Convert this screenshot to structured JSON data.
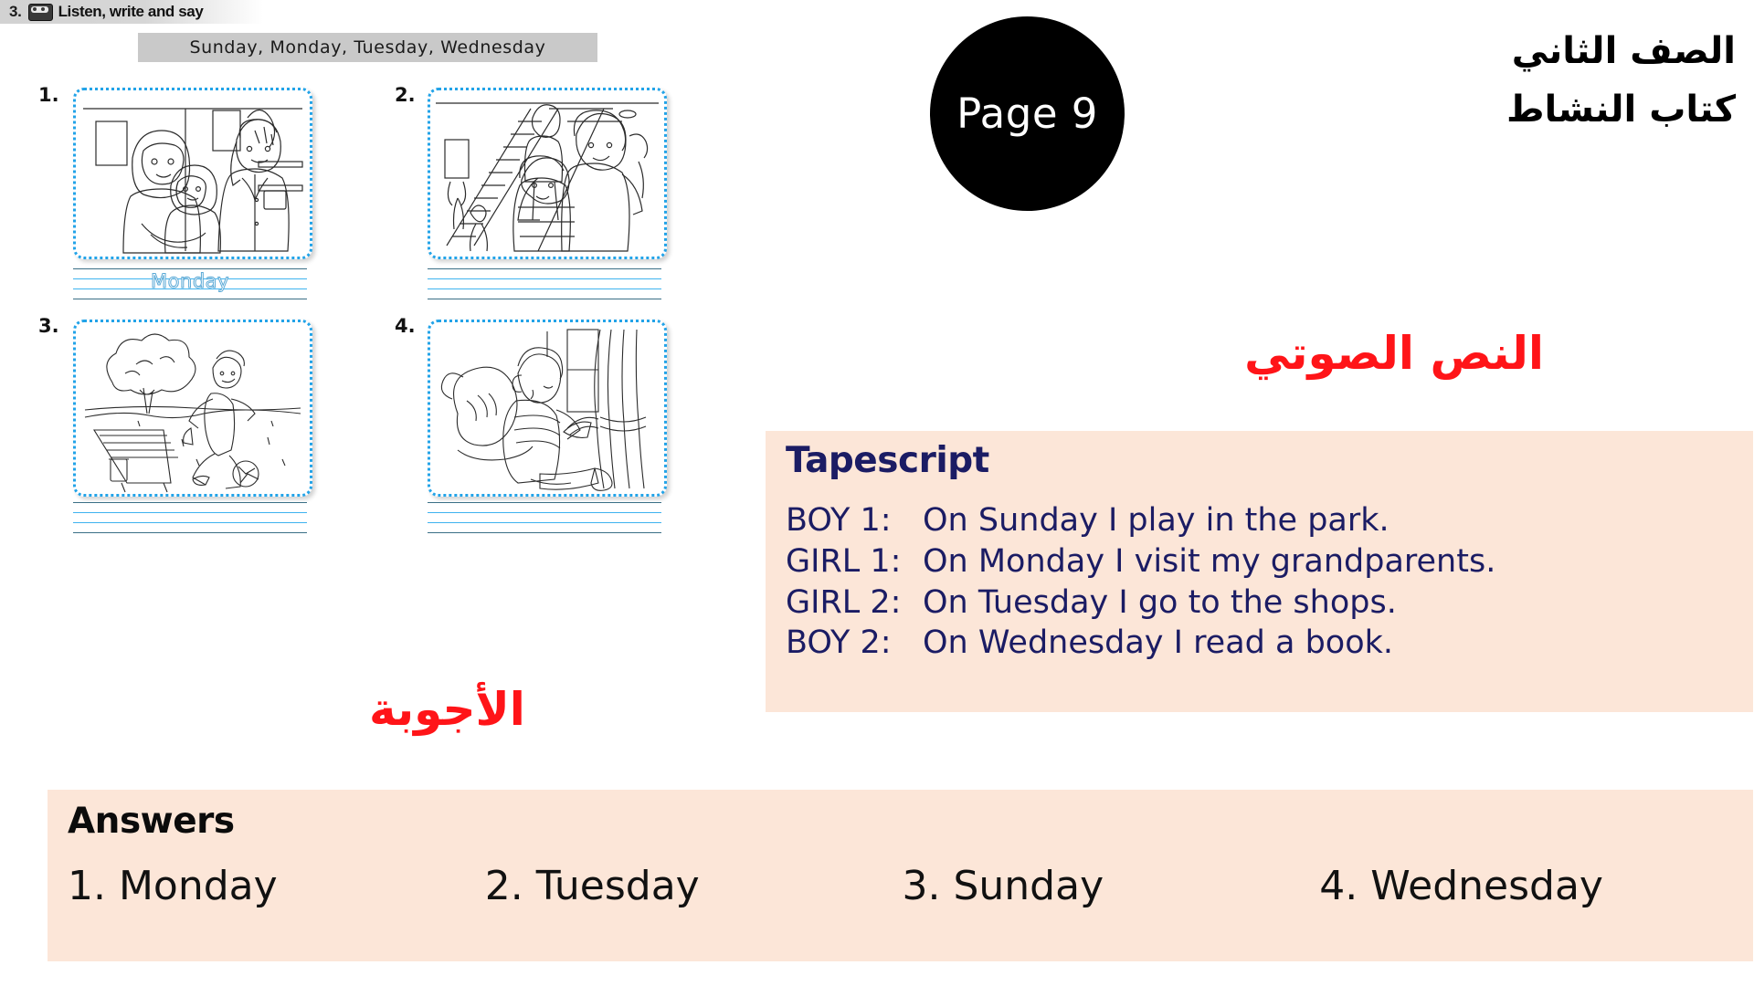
{
  "exercise": {
    "number": "3.",
    "icon": "cassette-icon",
    "title": "Listen, write and say",
    "word_bank": "Sunday,  Monday,  Tuesday,  Wednesday"
  },
  "page_badge": {
    "label": "Page 9"
  },
  "arabic_header": {
    "line1": "الصف الثاني",
    "line2": "كتاب النشاط"
  },
  "section_labels": {
    "tapescript_arabic": "النص الصوتي",
    "answers_arabic": "الأجوبة"
  },
  "panels": [
    {
      "number": "1.",
      "scene": "family-grandparents-scene",
      "written_answer": "Monday"
    },
    {
      "number": "2.",
      "scene": "shopping-mall-escalator-scene",
      "written_answer": ""
    },
    {
      "number": "3.",
      "scene": "boy-playing-football-park-scene",
      "written_answer": ""
    },
    {
      "number": "4.",
      "scene": "boy-reading-book-scene",
      "written_answer": ""
    }
  ],
  "tapescript": {
    "title": "Tapescript",
    "lines": [
      {
        "speaker": "BOY 1:",
        "text": "On Sunday I play in the park."
      },
      {
        "speaker": "GIRL 1:",
        "text": "On Monday I visit my grandparents."
      },
      {
        "speaker": "GIRL 2:",
        "text": "On Tuesday I go to the shops."
      },
      {
        "speaker": "BOY 2:",
        "text": "On Wednesday I read a book."
      }
    ]
  },
  "answers": {
    "title": "Answers",
    "items": [
      "1. Monday",
      "2. Tuesday",
      "3. Sunday",
      "4. Wednesday"
    ]
  },
  "colors": {
    "accent_red": "#ff1418",
    "navy": "#1b1c64",
    "cream": "#fce6d8",
    "frame_blue": "#22a3e8",
    "badge_black": "#000000"
  }
}
